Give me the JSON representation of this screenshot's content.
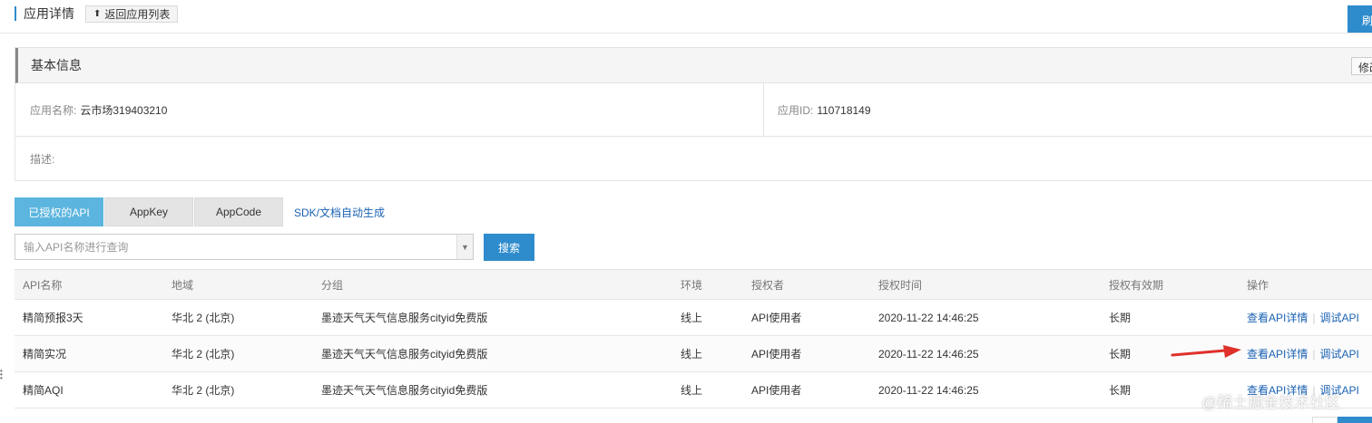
{
  "header": {
    "title": "应用详情",
    "back_label": "返回应用列表",
    "refresh_label": "刷"
  },
  "basic_info": {
    "title": "基本信息",
    "edit_label": "修改",
    "app_name_label": "应用名称:",
    "app_name_value": "云市场319403210",
    "app_id_label": "应用ID:",
    "app_id_value": "110718149",
    "desc_label": "描述:"
  },
  "tabs": [
    {
      "label": "已授权的API",
      "active": true
    },
    {
      "label": "AppKey",
      "active": false
    },
    {
      "label": "AppCode",
      "active": false
    }
  ],
  "sdk_link": "SDK/文档自动生成",
  "search": {
    "placeholder": "输入API名称进行查询",
    "button_label": "搜索"
  },
  "table": {
    "columns": [
      "API名称",
      "地域",
      "分组",
      "环境",
      "授权者",
      "授权时间",
      "授权有效期",
      "操作"
    ],
    "rows": [
      {
        "name": "精简预报3天",
        "region": "华北 2 (北京)",
        "group": "墨迹天气天气信息服务cityid免费版",
        "env": "线上",
        "grantor": "API使用者",
        "time": "2020-11-22 14:46:25",
        "validity": "长期"
      },
      {
        "name": "精简实况",
        "region": "华北 2 (北京)",
        "group": "墨迹天气天气信息服务cityid免费版",
        "env": "线上",
        "grantor": "API使用者",
        "time": "2020-11-22 14:46:25",
        "validity": "长期"
      },
      {
        "name": "精简AQI",
        "region": "华北 2 (北京)",
        "group": "墨迹天气天气信息服务cityid免费版",
        "env": "线上",
        "grantor": "API使用者",
        "time": "2020-11-22 14:46:25",
        "validity": "长期"
      }
    ],
    "actions": {
      "view": "查看API详情",
      "separator": "|",
      "debug": "调试API"
    }
  },
  "watermark": "@稀土掘金技术社区",
  "colors": {
    "primary": "#2e8bcc",
    "tab_active": "#5bb5de",
    "link": "#1b62b3",
    "annotation_arrow": "#e0302a"
  }
}
